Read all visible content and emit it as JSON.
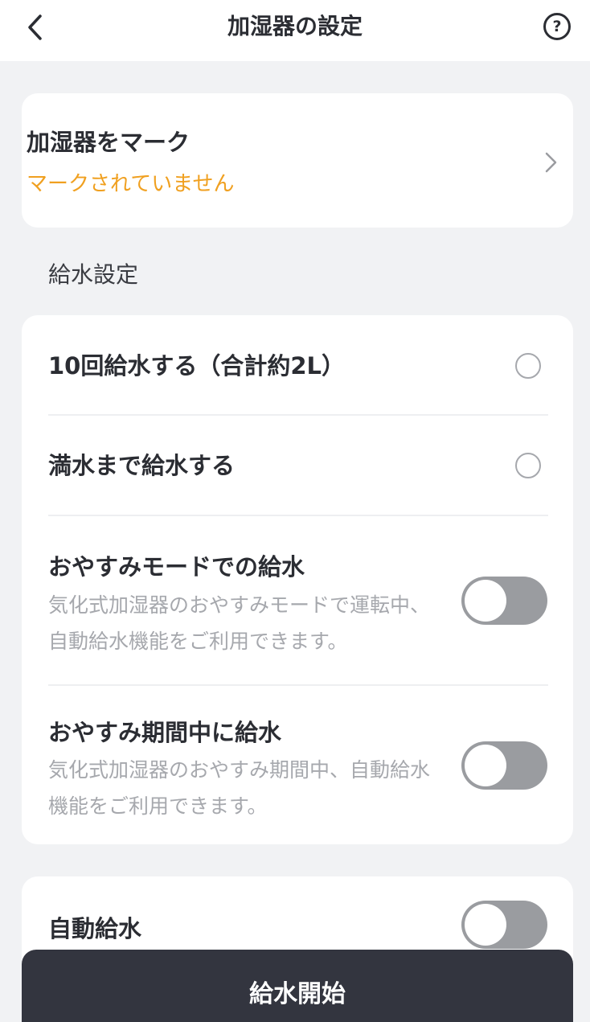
{
  "header": {
    "title": "加湿器の設定",
    "help_glyph": "?"
  },
  "mark": {
    "title": "加湿器をマーク",
    "status": "マークされていません"
  },
  "water_settings": {
    "section_label": "給水設定",
    "options": [
      {
        "label": "10回給水する（合計約2L）",
        "selected": false
      },
      {
        "label": "満水まで給水する",
        "selected": false
      }
    ],
    "toggles": [
      {
        "label": "おやすみモードでの給水",
        "description": "気化式加湿器のおやすみモードで運転中、自動給水機能をご利用できます。",
        "on": false
      },
      {
        "label": "おやすみ期間中に給水",
        "description": "気化式加湿器のおやすみ期間中、自動給水機能をご利用できます。",
        "on": false
      }
    ]
  },
  "auto_water": {
    "label": "自動給水",
    "on": false
  },
  "actions": {
    "start_label": "給水開始"
  },
  "colors": {
    "background": "#f1f2f4",
    "card": "#ffffff",
    "accent_orange": "#f0a020",
    "text_primary": "#2b2d33",
    "text_secondary": "#a6a8ad",
    "toggle_off": "#9a9ca0",
    "button_dark": "#33353f"
  },
  "icons": {
    "back": "chevron-left-icon",
    "help": "question-circle-icon",
    "mark_arrow": "chevron-right-icon"
  }
}
